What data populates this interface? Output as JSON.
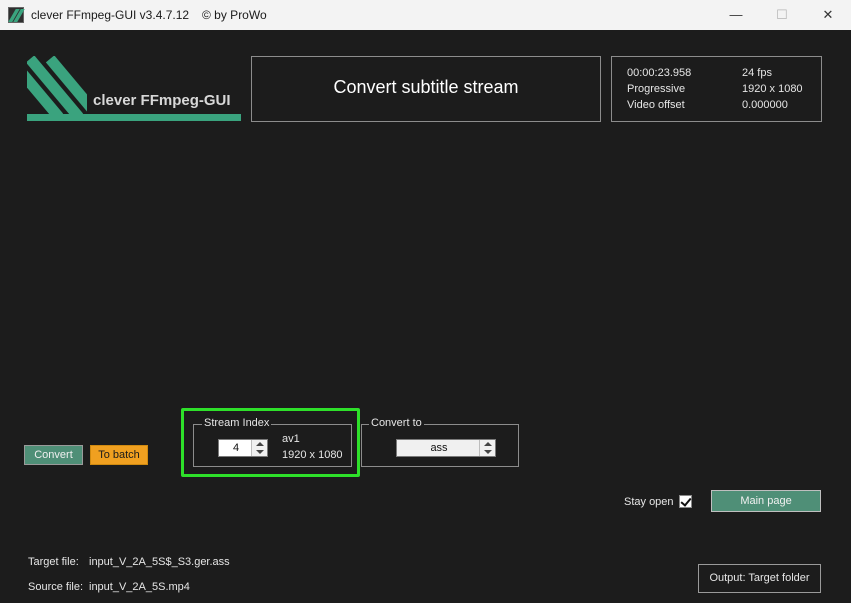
{
  "window": {
    "title": "clever FFmpeg-GUI v3.4.7.12",
    "copyright": "© by ProWo",
    "minimize": "—",
    "maximize": "☐",
    "close": "✕"
  },
  "logo": {
    "text": "clever FFmpeg-GUI"
  },
  "header": {
    "title": "Convert subtitle stream"
  },
  "info": {
    "time": "00:00:23.958",
    "fps": "24 fps",
    "scan": "Progressive",
    "resolution": "1920 x 1080",
    "offset_label": "Video offset",
    "offset_value": "0.000000"
  },
  "buttons": {
    "convert": "Convert",
    "to_batch": "To batch",
    "main_page": "Main page",
    "output": "Output: Target folder"
  },
  "stream_index": {
    "legend": "Stream Index",
    "value": "4",
    "codec": "av1",
    "resolution": "1920 x 1080"
  },
  "convert_to": {
    "legend": "Convert to",
    "value": "ass"
  },
  "stay_open": {
    "label": "Stay open",
    "checked": true
  },
  "files": {
    "target_label": "Target file:",
    "target_value": "input_V_2A_5S$_S3.ger.ass",
    "source_label": "Source file:",
    "source_value": "input_V_2A_5S.mp4"
  },
  "colors": {
    "accent_green": "#3aa37e",
    "button_green": "#4f8f77",
    "batch_orange": "#f0a020",
    "highlight": "#2ee02a",
    "background": "#1c1c1c"
  }
}
